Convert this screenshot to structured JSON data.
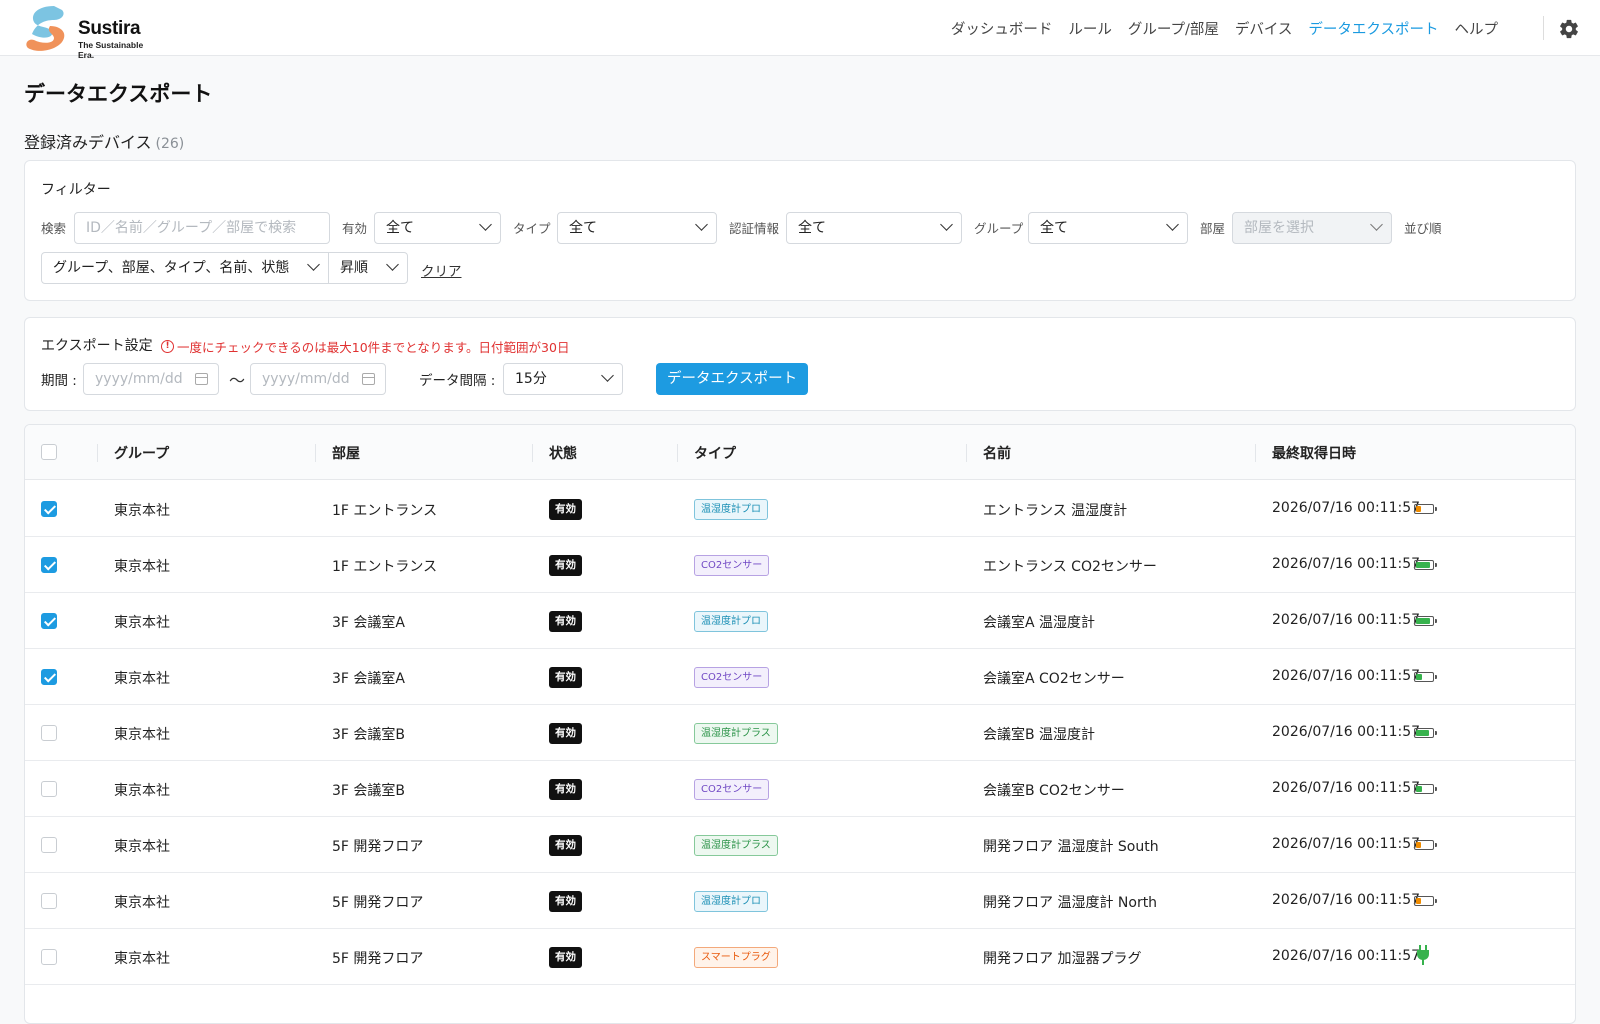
{
  "app": {
    "logo_name": "Sustira",
    "logo_tagline": "The Sustainable Era.",
    "nav": [
      "ダッシュボード",
      "ルール",
      "グループ/部屋",
      "デバイス",
      "データエクスポート",
      "ヘルプ"
    ],
    "active_nav": "データエクスポート",
    "accent_color": "#1d9be1"
  },
  "page": {
    "title": "データエクスポート",
    "devices_label": "登録済みデバイス",
    "devices_count": "(26)"
  },
  "filter": {
    "title": "フィルター",
    "search_label": "検索",
    "search_placeholder": "ID／名前／グループ／部屋で検索",
    "enabled_label": "有効",
    "enabled_value": "全て",
    "type_label": "タイプ",
    "type_value": "全て",
    "auth_label": "認証情報",
    "auth_value": "全て",
    "group_label": "グループ",
    "group_value": "全て",
    "room_label": "部屋",
    "room_placeholder": "部屋を選択",
    "sort_label": "並び順",
    "sort_value": "グループ、部屋、タイプ、名前、状態",
    "order_value": "昇順",
    "clear_label": "クリア"
  },
  "export": {
    "title": "エクスポート設定",
    "warning": "一度にチェックできるのは最大10件までとなります。日付範囲が30日",
    "period_label": "期間 :",
    "date_placeholder": "yyyy/mm/dd",
    "tilde": "〜",
    "interval_label": "データ間隔 :",
    "interval_value": "15分",
    "export_button": "データエクスポート"
  },
  "table": {
    "headers": [
      "グループ",
      "部屋",
      "状態",
      "タイプ",
      "名前",
      "最終取得日時"
    ],
    "rows": [
      {
        "checked": true,
        "group": "東京本社",
        "room": "1F エントランス",
        "status": "有効",
        "type": "温湿度計プロ",
        "name": "エントランス 温湿度計",
        "last": "2026/07/16 00:11:57",
        "power": "battery",
        "level": 0.3
      },
      {
        "checked": true,
        "group": "東京本社",
        "room": "1F エントランス",
        "status": "有効",
        "type": "CO2センサー",
        "name": "エントランス CO2センサー",
        "last": "2026/07/16 00:11:57",
        "power": "battery",
        "level": 0.9
      },
      {
        "checked": true,
        "group": "東京本社",
        "room": "3F 会議室A",
        "status": "有効",
        "type": "温湿度計プロ",
        "name": "会議室A 温湿度計",
        "last": "2026/07/16 00:11:57",
        "power": "battery",
        "level": 0.9
      },
      {
        "checked": true,
        "group": "東京本社",
        "room": "3F 会議室A",
        "status": "有効",
        "type": "CO2センサー",
        "name": "会議室A CO2センサー",
        "last": "2026/07/16 00:11:57",
        "power": "battery",
        "level": 0.4
      },
      {
        "checked": false,
        "group": "東京本社",
        "room": "3F 会議室B",
        "status": "有効",
        "type": "温湿度計プラス",
        "name": "会議室B 温湿度計",
        "last": "2026/07/16 00:11:57",
        "power": "battery",
        "level": 0.8
      },
      {
        "checked": false,
        "group": "東京本社",
        "room": "3F 会議室B",
        "status": "有効",
        "type": "CO2センサー",
        "name": "会議室B CO2センサー",
        "last": "2026/07/16 00:11:57",
        "power": "battery",
        "level": 0.4
      },
      {
        "checked": false,
        "group": "東京本社",
        "room": "5F 開発フロア",
        "status": "有効",
        "type": "温湿度計プラス",
        "name": "開発フロア 温湿度計 South",
        "last": "2026/07/16 00:11:57",
        "power": "battery",
        "level": 0.3
      },
      {
        "checked": false,
        "group": "東京本社",
        "room": "5F 開発フロア",
        "status": "有効",
        "type": "温湿度計プロ",
        "name": "開発フロア 温湿度計 North",
        "last": "2026/07/16 00:11:57",
        "power": "battery",
        "level": 0.3
      },
      {
        "checked": false,
        "group": "東京本社",
        "room": "5F 開発フロア",
        "status": "有効",
        "type": "スマートプラグ",
        "name": "開発フロア 加湿器プラグ",
        "last": "2026/07/16 00:11:57",
        "power": "plug",
        "level": null
      }
    ],
    "type_colors": {
      "温湿度計プロ": {
        "fg": "#1a8fb5",
        "bg": "#eaf6fb",
        "border": "#7fc4dc"
      },
      "CO2センサー": {
        "fg": "#7048c4",
        "bg": "#f3effc",
        "border": "#b7a2e3"
      },
      "温湿度計プラス": {
        "fg": "#2b9348",
        "bg": "#edf8f0",
        "border": "#86c99a"
      },
      "スマートプラグ": {
        "fg": "#e8590c",
        "bg": "#fff3ea",
        "border": "#f3a97b"
      }
    },
    "battery_colors": {
      "low": "#f08c00",
      "high": "#37b24d"
    }
  }
}
